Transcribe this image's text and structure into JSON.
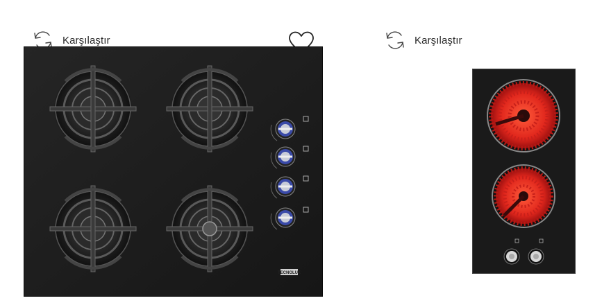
{
  "products": [
    {
      "compare_label": "Karşılaştır",
      "image_name": "gas-hob-4-burner-black-glass",
      "brand_mark": "TECNOLUX"
    },
    {
      "compare_label": "Karşılaştır",
      "image_name": "ceramic-domino-hob-2-zone"
    }
  ],
  "icons": {
    "compare": "compare-arrows-icon",
    "favorite": "heart-outline-icon"
  },
  "colors": {
    "hob_glass": "#1a1a1a",
    "heating_red": "#e0261c",
    "knob_blue": "#3a4aa8"
  }
}
